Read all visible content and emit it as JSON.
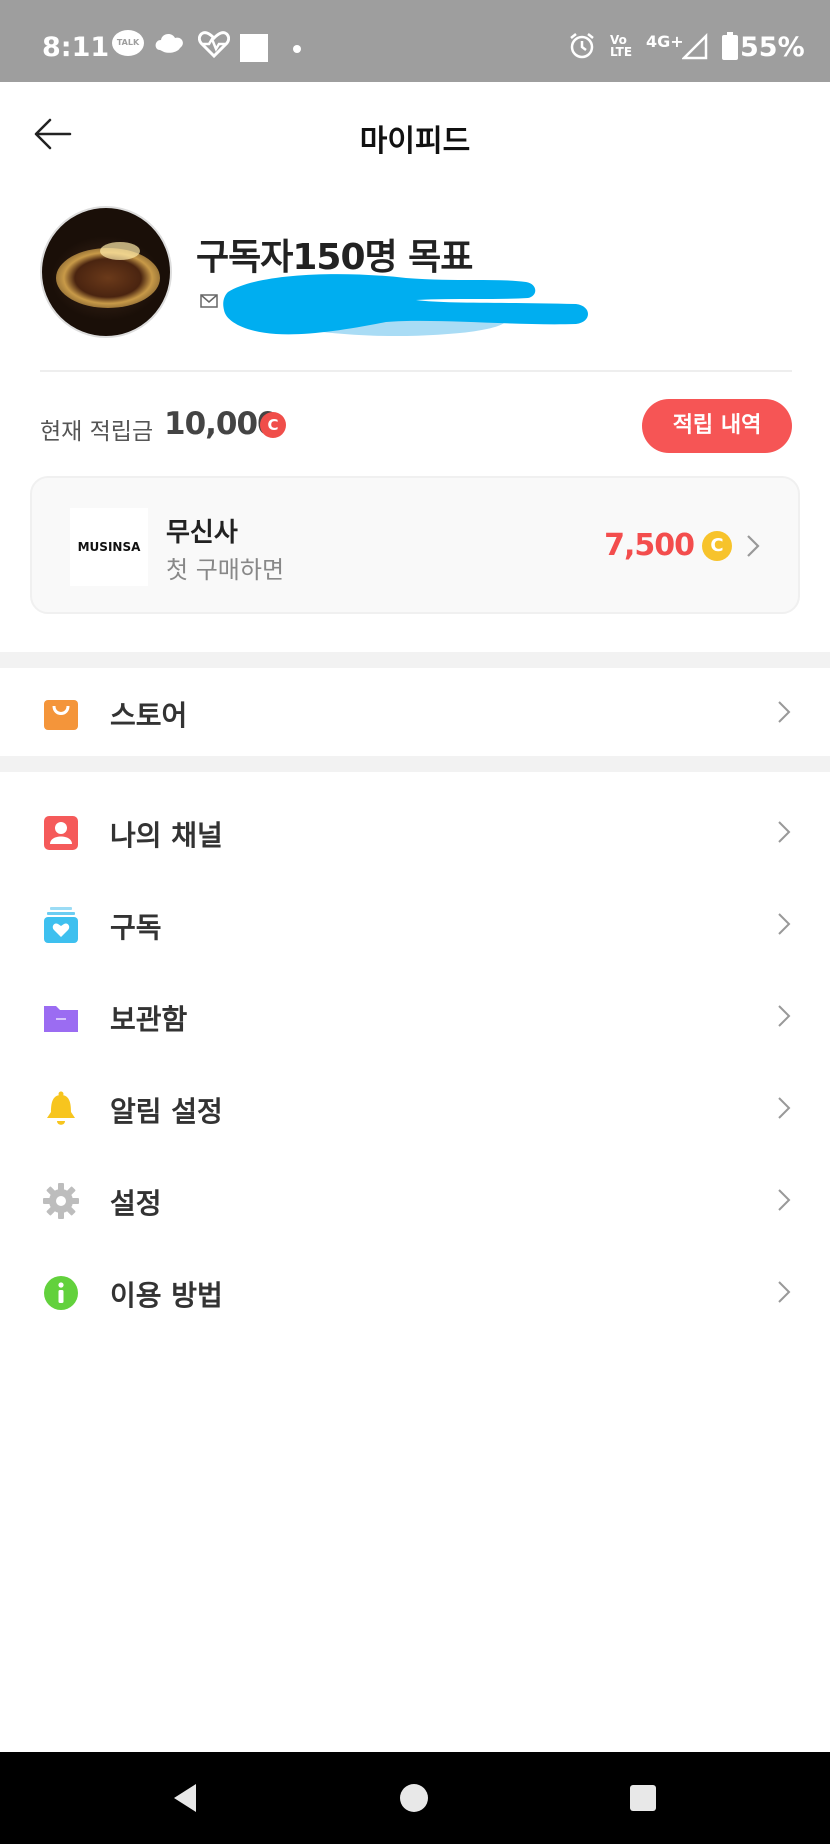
{
  "status_bar": {
    "time": "8:11",
    "talk_label": "TALK",
    "volte_top": "Vo",
    "volte_bottom": "LTE",
    "network": "4G+",
    "battery": "55%"
  },
  "header": {
    "title": "마이피드"
  },
  "profile": {
    "name": "구독자150명 목표"
  },
  "points": {
    "label": "현재 적립금",
    "value": "10,000",
    "currency_symbol": "C",
    "history_button": "적립 내역"
  },
  "promo": {
    "logo_text": "MUSINSA",
    "brand": "무신사",
    "description": "첫 구매하면",
    "amount": "7,500",
    "currency_symbol": "C"
  },
  "menu": {
    "store": {
      "label": "스토어",
      "icon": "shopping-bag-icon",
      "color": "#f4953a"
    },
    "items": [
      {
        "label": "나의 채널",
        "icon": "person-icon",
        "color": "#f55a5a"
      },
      {
        "label": "구독",
        "icon": "subscription-heart-icon",
        "color": "#3ec0ef"
      },
      {
        "label": "보관함",
        "icon": "folder-icon",
        "color": "#9b6cf2"
      },
      {
        "label": "알림 설정",
        "icon": "bell-icon",
        "color": "#f7c51e"
      },
      {
        "label": "설정",
        "icon": "gear-icon",
        "color": "#bdbdbd"
      },
      {
        "label": "이용 방법",
        "icon": "info-icon",
        "color": "#62d13c"
      }
    ]
  },
  "colors": {
    "accent_red": "#f65555",
    "coin_yellow": "#f7c32b",
    "status_bar": "#9e9e9e"
  }
}
